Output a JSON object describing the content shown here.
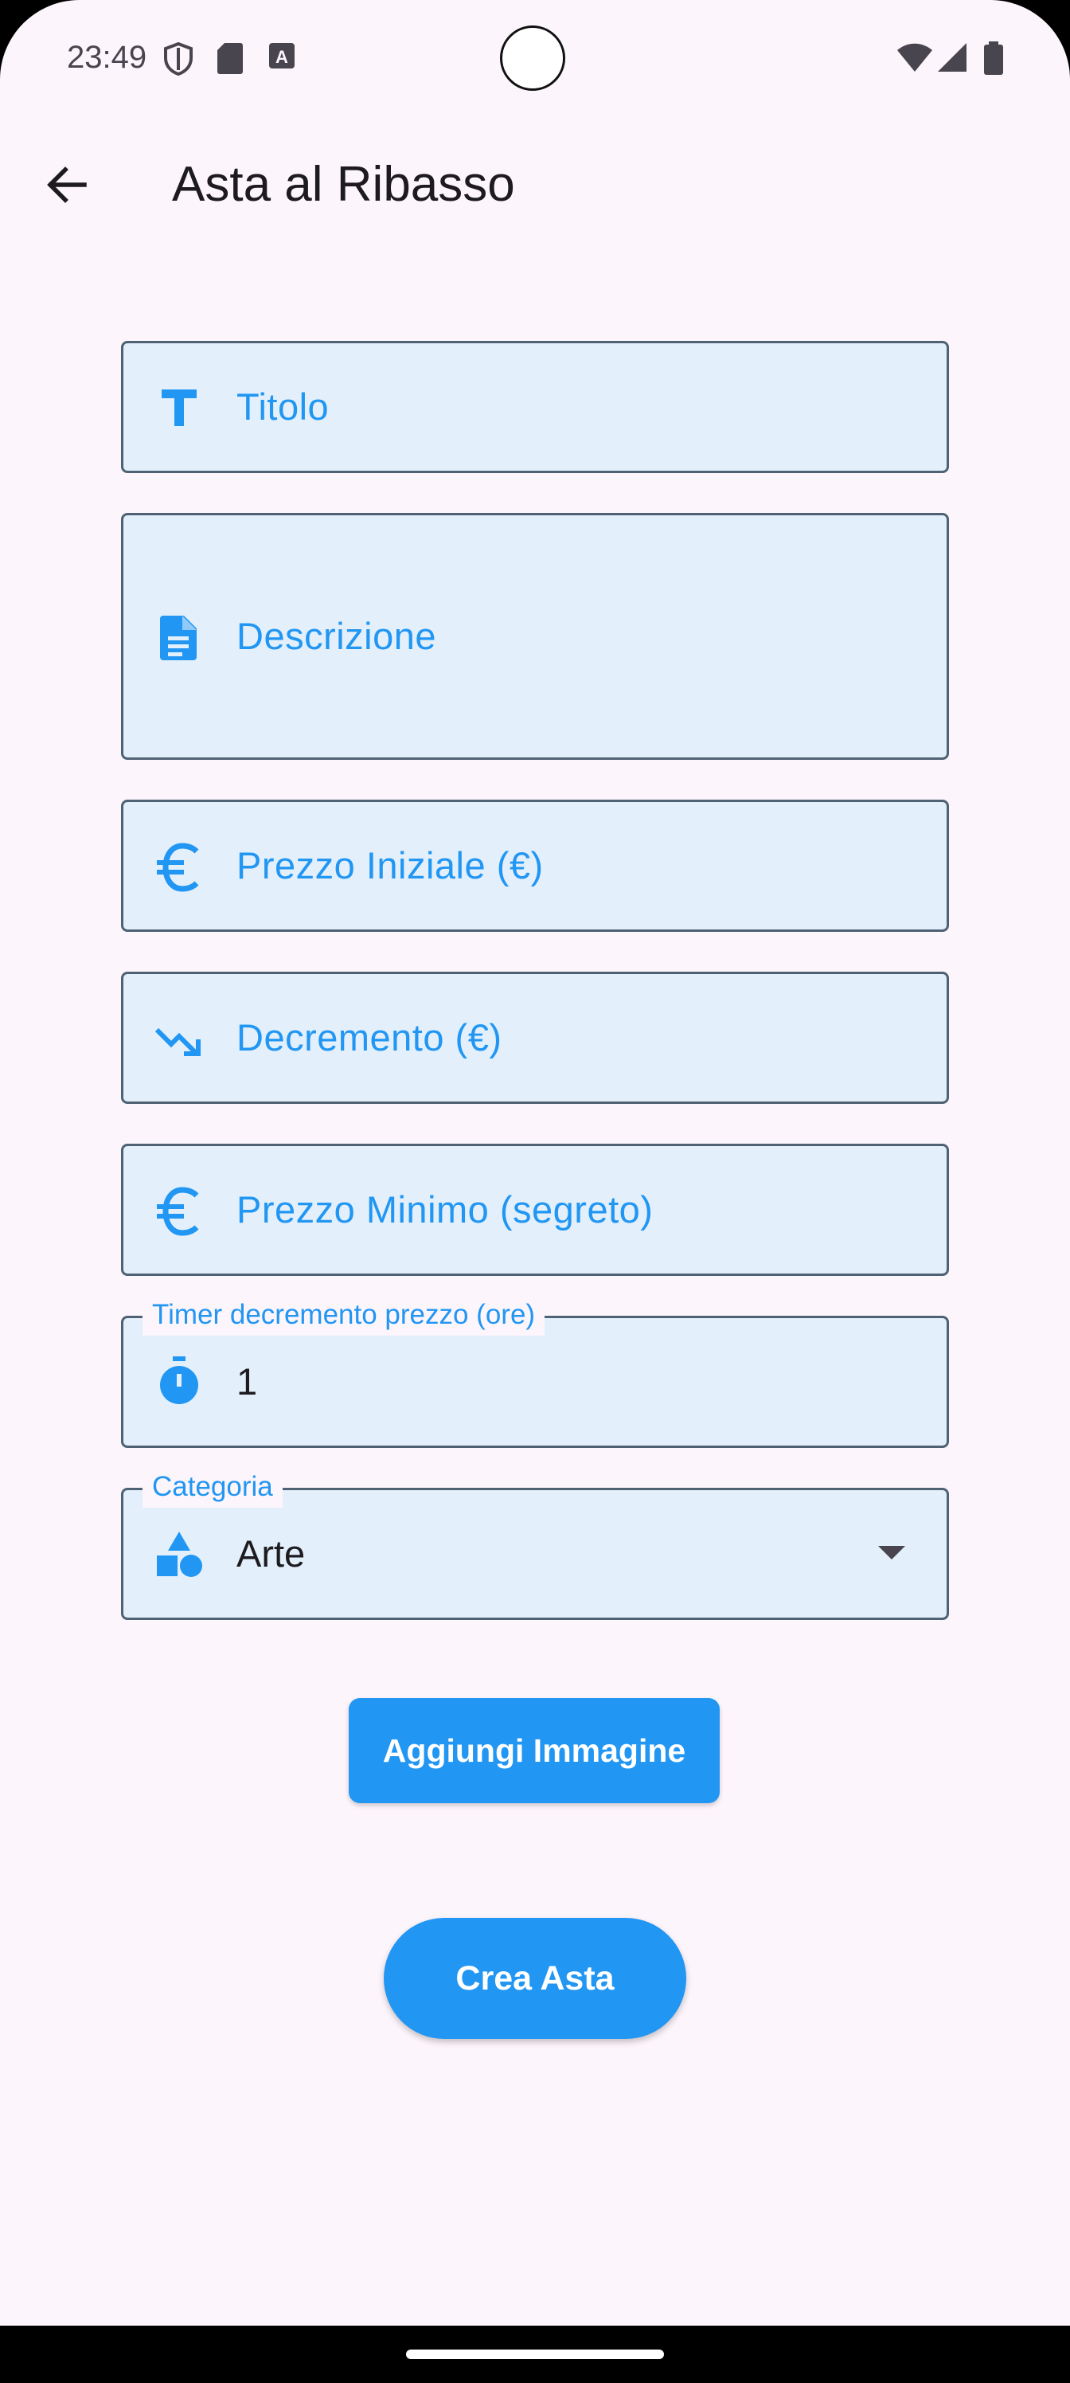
{
  "status_bar": {
    "time": "23:49"
  },
  "app_bar": {
    "title": "Asta al Ribasso"
  },
  "form": {
    "title_field": {
      "label": "Titolo"
    },
    "description_field": {
      "label": "Descrizione"
    },
    "initial_price_field": {
      "label": "Prezzo Iniziale (€)"
    },
    "decrement_field": {
      "label": "Decremento (€)"
    },
    "min_price_field": {
      "label": "Prezzo Minimo (segreto)"
    },
    "timer_field": {
      "label": "Timer decremento prezzo (ore)",
      "value": "1"
    },
    "category_field": {
      "label": "Categoria",
      "value": "Arte"
    }
  },
  "buttons": {
    "add_image": "Aggiungi Immagine",
    "create_auction": "Crea Asta"
  },
  "colors": {
    "accent": "#2196F3",
    "field_bg": "#E3F0FB",
    "page_bg": "#FCF5FB"
  }
}
